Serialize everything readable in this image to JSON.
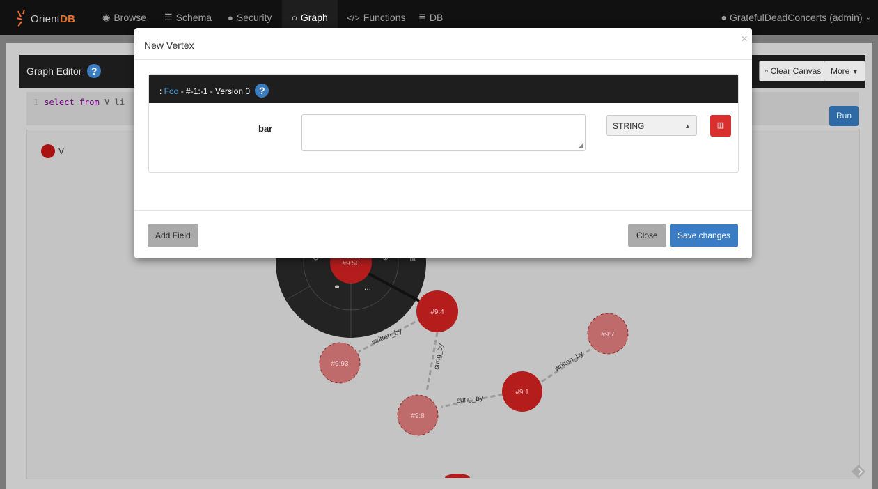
{
  "navbar": {
    "logo_prefix": "Orient",
    "logo_suffix": "DB",
    "items": [
      {
        "label": "Browse",
        "icon": "eye-icon"
      },
      {
        "label": "Schema",
        "icon": "table-icon"
      },
      {
        "label": "Security",
        "icon": "user-icon"
      },
      {
        "label": "Graph",
        "icon": "circle-icon",
        "active": true
      },
      {
        "label": "Functions",
        "icon": "code-icon"
      },
      {
        "label": "DB",
        "icon": "database-icon"
      }
    ],
    "user": "GratefulDeadConcerts (admin)"
  },
  "editor": {
    "title": "Graph Editor",
    "help": "?",
    "clear_canvas": "Clear Canvas",
    "more": "More",
    "query_line_no": "1",
    "query_kw1": "select",
    "query_kw2": "from",
    "query_rest": "V li",
    "run": "Run"
  },
  "legend": {
    "label": "V"
  },
  "graph": {
    "nodes": [
      {
        "id": "#9:50"
      },
      {
        "id": "#9:4"
      },
      {
        "id": "#9:93"
      },
      {
        "id": "#9:8"
      },
      {
        "id": "#9:1"
      },
      {
        "id": "#9:7"
      }
    ],
    "edges": [
      {
        "label": "written_by"
      },
      {
        "label": "sung_by"
      },
      {
        "label": "sung_by"
      },
      {
        "label": "written_by"
      }
    ],
    "menu_more": "..."
  },
  "modal": {
    "title": "New Vertex",
    "close_x": "×",
    "record_prefix": ": ",
    "record_class": "Foo",
    "record_info": " - #-1:-1 - Version 0",
    "help": "?",
    "field_name": "bar",
    "field_value": "",
    "field_type": "STRING",
    "add_field": "Add Field",
    "close": "Close",
    "save": "Save changes"
  },
  "colors": {
    "accent": "#3b7dc4",
    "node": "#b51d1d",
    "danger": "#d9302f"
  }
}
